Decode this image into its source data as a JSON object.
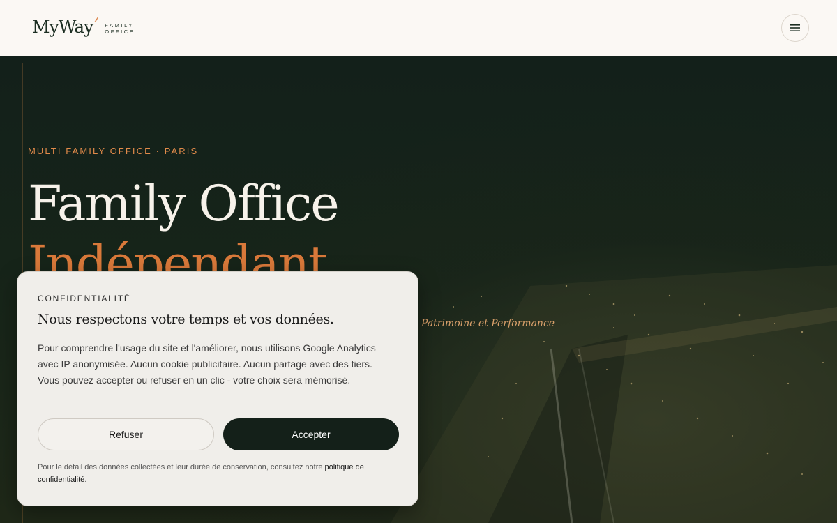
{
  "header": {
    "logo_main": "MyWay",
    "logo_sub_1": "FAMILY",
    "logo_sub_2": "OFFICE",
    "menu_icon": "hamburger-icon",
    "accent": "#d9793a"
  },
  "hero": {
    "eyebrow": "MULTI FAMILY OFFICE · PARIS",
    "headline_1": "Family Office",
    "headline_2": "Indépendant",
    "tagline": "Patrimoine et Performance"
  },
  "cookie": {
    "eyebrow": "CONFIDENTIALITÉ",
    "title": "Nous respectons votre temps et vos données.",
    "body": "Pour comprendre l'usage du site et l'améliorer, nous utilisons Google Analytics avec IP anonymisée. Aucun cookie publicitaire. Aucun partage avec des tiers. Vous pouvez accepter ou refuser en un clic - votre choix sera mémorisé.",
    "refuse_label": "Refuser",
    "accept_label": "Accepter",
    "footer_text": "Pour le détail des données collectées et leur durée de conservation, consultez notre ",
    "footer_link": "politique de confidentialité",
    "footer_end": "."
  }
}
